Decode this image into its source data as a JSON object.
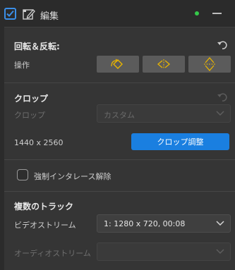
{
  "header": {
    "title": "編集",
    "enabled": true,
    "status_color": "#35c94a"
  },
  "rotate_flip": {
    "title": "回転＆反転:",
    "operation_label": "操作",
    "buttons": [
      {
        "name": "rotate",
        "icon": "rotate-icon"
      },
      {
        "name": "flip-horizontal",
        "icon": "flip-horizontal-icon"
      },
      {
        "name": "flip-vertical",
        "icon": "flip-vertical-icon"
      }
    ]
  },
  "crop": {
    "title": "クロップ",
    "crop_label": "クロップ",
    "crop_value": "カスタム",
    "resolution": "1440 x 2560",
    "adjust_button": "クロップ調整"
  },
  "deinterlace": {
    "label": "強制インタレース解除",
    "checked": false
  },
  "tracks": {
    "title": "複数のトラック",
    "video_label": "ビデオストリーム",
    "video_value": "1: 1280 x 720,  00:08",
    "audio_label": "オーディオストリーム",
    "audio_value": ""
  },
  "colors": {
    "accent": "#1a7fe0",
    "icon_yellow": "#e8b400",
    "panel": "#353535",
    "background": "#2b2b2b"
  }
}
